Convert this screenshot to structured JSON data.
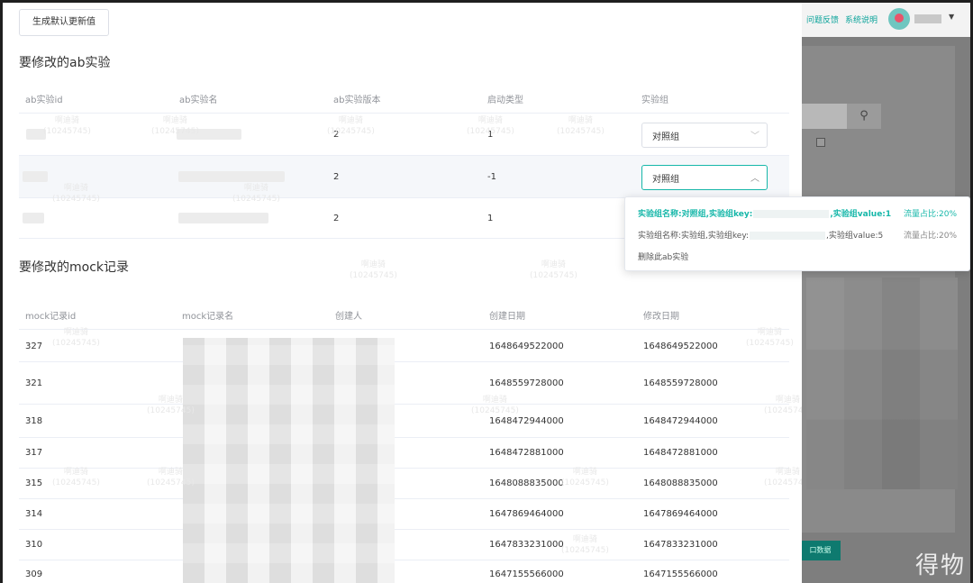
{
  "background_app": {
    "header_links": [
      "问题反馈",
      "系统说明"
    ],
    "search_icon": "search-icon"
  },
  "modal": {
    "generate_button": "生成默认更新值",
    "ab_section": {
      "title": "要修改的ab实验",
      "columns": [
        "ab实验id",
        "ab实验名",
        "ab实验版本",
        "启动类型",
        "实验组"
      ],
      "rows": [
        {
          "version": "2",
          "start_type": "1",
          "group": "对照组"
        },
        {
          "version": "2",
          "start_type": "-1",
          "group": "对照组"
        },
        {
          "version": "2",
          "start_type": "1"
        }
      ]
    },
    "mock_section": {
      "title": "要修改的mock记录",
      "columns": [
        "mock记录id",
        "mock记录名",
        "创建人",
        "创建日期",
        "修改日期"
      ],
      "rows": [
        {
          "id": "327",
          "created": "1648649522000",
          "modified": "1648649522000"
        },
        {
          "id": "321",
          "created": "1648559728000",
          "modified": "1648559728000"
        },
        {
          "id": "318",
          "created": "1648472944000",
          "modified": "1648472944000"
        },
        {
          "id": "317",
          "created": "1648472881000",
          "modified": "1648472881000"
        },
        {
          "id": "315",
          "created": "1648088835000",
          "modified": "1648088835000"
        },
        {
          "id": "314",
          "created": "1647869464000",
          "modified": "1647869464000"
        },
        {
          "id": "310",
          "created": "1647833231000",
          "modified": "1647833231000"
        },
        {
          "id": "309",
          "created": "1647155566000",
          "modified": "1647155566000"
        }
      ]
    },
    "watermark": "啊迪骑\n(10245745)"
  },
  "dropdown": {
    "options": [
      {
        "prefix": "实验组名称:对照组,实验组key:",
        "suffix": ",实验组value:1",
        "ratio": "流量占比:20%",
        "selected": true
      },
      {
        "prefix": "实验组名称:实验组,实验组key:",
        "suffix": ",实验组value:5",
        "ratio": "流量占比:20%",
        "selected": false
      },
      {
        "prefix": "删除此ab实验",
        "suffix": "",
        "ratio": "",
        "selected": false
      }
    ]
  },
  "corner_watermark": "得物",
  "colors": {
    "accent": "#16b7a9",
    "header_text": "#909399"
  }
}
